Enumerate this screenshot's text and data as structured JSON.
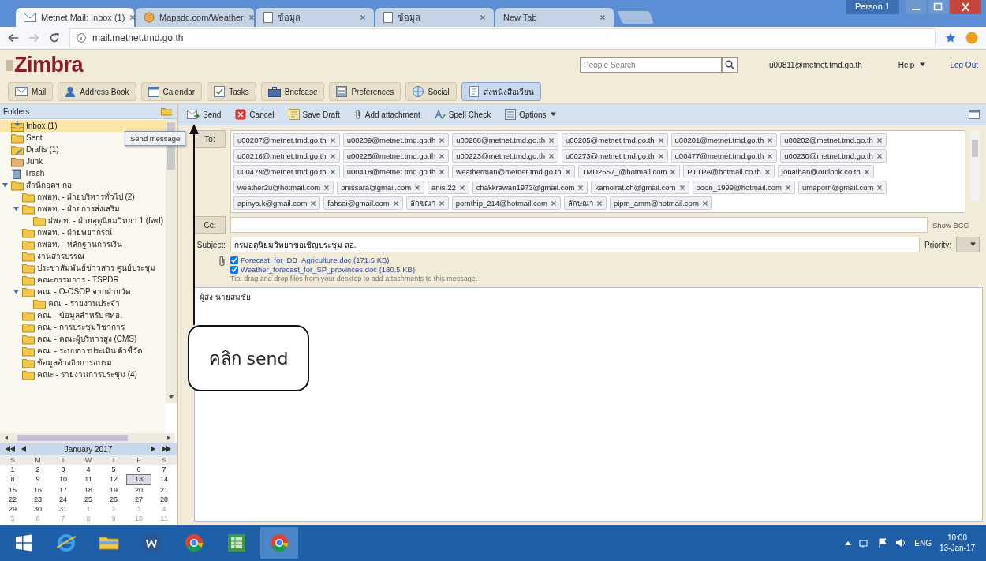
{
  "browser": {
    "tabs": [
      {
        "title": "Metnet Mail: Inbox (1)",
        "kind": "mail",
        "selected": true
      },
      {
        "title": "Mapsdc.com/Weather",
        "kind": "site",
        "selected": false
      },
      {
        "title": "ข้อมูล",
        "kind": "page",
        "selected": false
      },
      {
        "title": "ข้อมูล",
        "kind": "page",
        "selected": false
      },
      {
        "title": "New Tab",
        "kind": "blank",
        "selected": false
      }
    ],
    "profile": "Person 1",
    "address": "mail.metnet.tmd.go.th"
  },
  "app": {
    "logo": "Zimbra",
    "search": {
      "placeholder": "People Search"
    },
    "user": "u00811@metnet.tmd.go.th",
    "help": "Help",
    "logout": "Log Out",
    "tabs": [
      {
        "label": "Mail",
        "kind": "mail",
        "selected": false
      },
      {
        "label": "Address Book",
        "kind": "contacts",
        "selected": false
      },
      {
        "label": "Calendar",
        "kind": "calendar",
        "selected": false
      },
      {
        "label": "Tasks",
        "kind": "tasks",
        "selected": false
      },
      {
        "label": "Briefcase",
        "kind": "briefcase",
        "selected": false
      },
      {
        "label": "Preferences",
        "kind": "preferences",
        "selected": false
      },
      {
        "label": "Social",
        "kind": "social",
        "selected": false
      },
      {
        "label": "ส่งหนังสือเวียน",
        "kind": "compose",
        "selected": true
      }
    ]
  },
  "sidebar": {
    "title": "Folders",
    "folders": [
      {
        "label": "Inbox (1)",
        "kind": "inbox",
        "selected": true,
        "expanded": false
      },
      {
        "label": "Sent",
        "kind": "sent",
        "selected": false,
        "expanded": false
      },
      {
        "label": "Drafts (1)",
        "kind": "drafts",
        "selected": false,
        "expanded": false
      },
      {
        "label": "Junk",
        "kind": "junk",
        "selected": false,
        "expanded": false
      },
      {
        "label": "Trash",
        "kind": "trash",
        "selected": false,
        "expanded": false
      },
      {
        "label": "สำนักอุตุฯ กอ",
        "kind": "folder",
        "selected": false,
        "expanded": true,
        "children": [
          {
            "label": "กพอท. - ฝ่ายบริหารทั่วไป (2)",
            "kind": "folder",
            "selected": false,
            "expanded": false
          },
          {
            "label": "กพอท. - ฝ่ายการส่งเสริม",
            "kind": "folder",
            "selected": false,
            "expanded": true,
            "children": [
              {
                "label": "ฝพอท. - ฝ่ายอุตุนิยมวิทยา 1 (fwd)",
                "kind": "folder",
                "selected": false,
                "expanded": false
              }
            ]
          },
          {
            "label": "กพอท. - ฝ่ายพยากรณ์",
            "kind": "folder",
            "selected": false,
            "expanded": false
          },
          {
            "label": "กพอท. - หลักฐานการเงิน",
            "kind": "folder",
            "selected": false,
            "expanded": false
          },
          {
            "label": "งานสารบรรณ",
            "kind": "folder",
            "selected": false,
            "expanded": false
          },
          {
            "label": "ประชาสัมพันธ์ข่าวสาร ศูนย์ประชุม",
            "kind": "folder",
            "selected": false,
            "expanded": false
          },
          {
            "label": "คณะกรรมการ - TSPDR",
            "kind": "folder",
            "selected": false,
            "expanded": false
          },
          {
            "label": "คณ. - O-OSOP จากฝ่ายวัด",
            "kind": "folder",
            "selected": false,
            "expanded": true,
            "children": [
              {
                "label": "คณ. - รายงานประจำ",
                "kind": "folder",
                "selected": false,
                "expanded": false
              }
            ]
          },
          {
            "label": "คณ. - ข้อมูลสำหรับ ศทอ.",
            "kind": "folder",
            "selected": false,
            "expanded": false
          },
          {
            "label": "คณ. - การประชุมวิชาการ",
            "kind": "folder",
            "selected": false,
            "expanded": false
          },
          {
            "label": "คณ. - คณะผู้บริหารสูง (CMS)",
            "kind": "folder",
            "selected": false,
            "expanded": false
          },
          {
            "label": "คณ. - ระบบการประเมิน ตัวชี้วัด",
            "kind": "folder",
            "selected": false,
            "expanded": false
          },
          {
            "label": "ข้อมูลอ้างอิงการอบรม",
            "kind": "folder",
            "selected": false,
            "expanded": false
          },
          {
            "label": "คณะ - รายงานการประชุม (4)",
            "kind": "folder",
            "selected": false,
            "expanded": false
          }
        ]
      }
    ]
  },
  "calendar": {
    "month": "January 2017",
    "weekdays": [
      "S",
      "M",
      "T",
      "W",
      "T",
      "F",
      "S"
    ],
    "days": [
      {
        "label": "1",
        "selected": false,
        "muted": false
      },
      {
        "label": "2",
        "selected": false,
        "muted": false
      },
      {
        "label": "3",
        "selected": false,
        "muted": false
      },
      {
        "label": "4",
        "selected": false,
        "muted": false
      },
      {
        "label": "5",
        "selected": false,
        "muted": false
      },
      {
        "label": "6",
        "selected": false,
        "muted": false
      },
      {
        "label": "7",
        "selected": false,
        "muted": false
      },
      {
        "label": "8",
        "selected": false,
        "muted": false
      },
      {
        "label": "9",
        "selected": false,
        "muted": false
      },
      {
        "label": "10",
        "selected": false,
        "muted": false
      },
      {
        "label": "11",
        "selected": false,
        "muted": false
      },
      {
        "label": "12",
        "selected": false,
        "muted": false
      },
      {
        "label": "13",
        "selected": true,
        "muted": false
      },
      {
        "label": "14",
        "selected": false,
        "muted": false
      },
      {
        "label": "15",
        "selected": false,
        "muted": false
      },
      {
        "label": "16",
        "selected": false,
        "muted": false
      },
      {
        "label": "17",
        "selected": false,
        "muted": false
      },
      {
        "label": "18",
        "selected": false,
        "muted": false
      },
      {
        "label": "19",
        "selected": false,
        "muted": false
      },
      {
        "label": "20",
        "selected": false,
        "muted": false
      },
      {
        "label": "21",
        "selected": false,
        "muted": false
      },
      {
        "label": "22",
        "selected": false,
        "muted": false
      },
      {
        "label": "23",
        "selected": false,
        "muted": false
      },
      {
        "label": "24",
        "selected": false,
        "muted": false
      },
      {
        "label": "25",
        "selected": false,
        "muted": false
      },
      {
        "label": "26",
        "selected": false,
        "muted": false
      },
      {
        "label": "27",
        "selected": false,
        "muted": false
      },
      {
        "label": "28",
        "selected": false,
        "muted": false
      },
      {
        "label": "29",
        "selected": false,
        "muted": false
      },
      {
        "label": "30",
        "selected": false,
        "muted": false
      },
      {
        "label": "31",
        "selected": false,
        "muted": false
      },
      {
        "label": "1",
        "selected": false,
        "muted": true
      },
      {
        "label": "2",
        "selected": false,
        "muted": true
      },
      {
        "label": "3",
        "selected": false,
        "muted": true
      },
      {
        "label": "4",
        "selected": false,
        "muted": true
      },
      {
        "label": "5",
        "selected": false,
        "muted": true
      },
      {
        "label": "6",
        "selected": false,
        "muted": true
      },
      {
        "label": "7",
        "selected": false,
        "muted": true
      },
      {
        "label": "8",
        "selected": false,
        "muted": true
      },
      {
        "label": "9",
        "selected": false,
        "muted": true
      },
      {
        "label": "10",
        "selected": false,
        "muted": true
      },
      {
        "label": "11",
        "selected": false,
        "muted": true
      }
    ]
  },
  "toolbar": [
    {
      "label": "Send",
      "kind": "send"
    },
    {
      "label": "Cancel",
      "kind": "cancel"
    },
    {
      "label": "Save Draft",
      "kind": "save"
    },
    {
      "label": "Add attachment",
      "kind": "attach"
    },
    {
      "label": "Spell Check",
      "kind": "spell"
    },
    {
      "label": "Options",
      "kind": "options"
    }
  ],
  "tooltip": "Send message",
  "compose": {
    "to_label": "To:",
    "to": [
      "u00207@metnet.tmd.go.th",
      "u00209@metnet.tmd.go.th",
      "u00208@metnet.tmd.go.th",
      "u00205@metnet.tmd.go.th",
      "u00201@metnet.tmd.go.th",
      "u00202@metnet.tmd.go.th",
      "u00216@metnet.tmd.go.th",
      "u00225@metnet.tmd.go.th",
      "u00223@metnet.tmd.go.th",
      "u00273@metnet.tmd.go.th",
      "u00477@metnet.tmd.go.th",
      "u00230@metnet.tmd.go.th",
      "u00479@metnet.tmd.go.th",
      "u00418@metnet.tmd.go.th",
      "weatherman@metnet.tmd.go.th",
      "TMD2557_@hotmail.com",
      "PTTPA@hotmail.co.th",
      "jonathan@outlook.co.th",
      "weather2u@hotmail.com",
      "pnissara@gmail.com",
      "anis.22",
      "chakkrawan1973@gmail.com",
      "kamolrat.ch@gmail.com",
      "ooon_1999@hotmail.com",
      "umaporn@gmail.com",
      "apinya.k@gmail.com",
      "fahsai@gmail.com",
      "ลักขณา",
      "pornthip_214@hotmail.com",
      "ลักษณา",
      "pipm_amm@hotmail.com"
    ],
    "cc_label": "Cc:",
    "show_bcc": "Show BCC",
    "subject_label": "Subject:",
    "subject": "กรมอุตุนิยมวิทยาขอเชิญประชุม สอ.",
    "priority_label": "Priority:",
    "attachments": [
      {
        "name": "Forecast_for_DB_Agriculture.doc (171.5 KB)",
        "checked": true
      },
      {
        "name": "Weather_forecast_for_SP_provinces.doc (180.5 KB)",
        "checked": true
      }
    ],
    "attach_hint": "Tip: drag and drop files from your desktop to add attachments to this message.",
    "body": "ผู้ส่ง นายสมชัย"
  },
  "callout": {
    "text": "คลิก send"
  },
  "taskbar": {
    "apps": [
      {
        "kind": "ie",
        "active": false
      },
      {
        "kind": "explorer",
        "active": false
      },
      {
        "kind": "word",
        "active": false
      },
      {
        "kind": "chrome",
        "active": false
      },
      {
        "kind": "sheet",
        "active": false
      },
      {
        "kind": "chrome",
        "active": true
      }
    ],
    "language": "ENG",
    "time": "10:00",
    "date": "13-Jan-17"
  }
}
